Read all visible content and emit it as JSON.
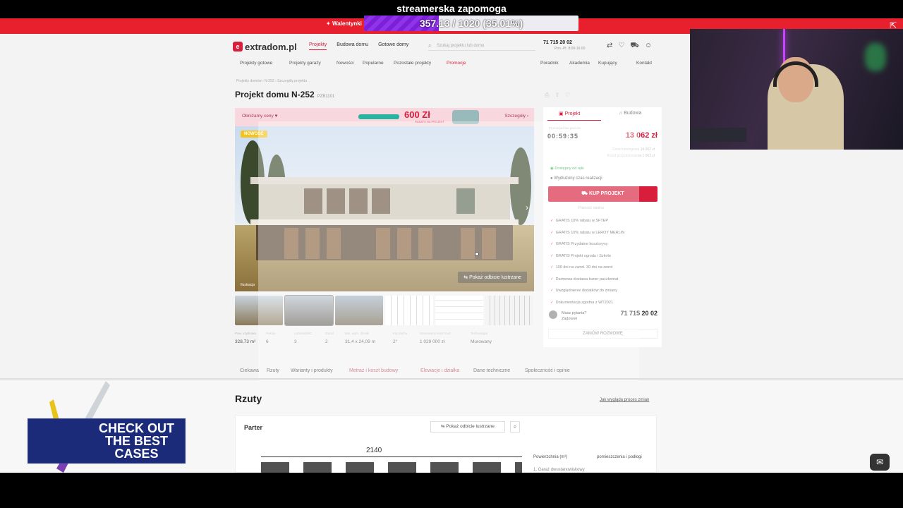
{
  "stream": {
    "title": "streamerska zapomoga",
    "badge_label": "Walentynki",
    "goal_text": "357.13 / 1020 (35.01%)",
    "goal_fraction": 0.3501
  },
  "site": {
    "logo": "extradom.pl",
    "nav": [
      "Projekty",
      "Budowa domu",
      "Gotowe domy"
    ],
    "search_placeholder": "Szukaj projektu lub domu",
    "phone": "71 715 20 02",
    "phone_sub": "Pon.-Pt. 8:00-16:00",
    "subnav_left": [
      "Projekty gotowe",
      "Projekty garaży",
      "Nowości",
      "Popularne",
      "Pozostałe projekty",
      "Promocje"
    ],
    "subnav_right": [
      "Poradnik",
      "Akademia",
      "Kupujący",
      "Kontakt"
    ],
    "breadcrumbs": "Projekty domów  ›  N-252  ›  Szczegóły projektu",
    "title": "Projekt domu N-252",
    "code": "PZB1101",
    "promo_left": "Obniżamy ceny",
    "promo_amount": "600 Zł",
    "promo_amount_sub": "RABATU NA PROJEKT",
    "promo_right": "Szczegóły",
    "hero_badge": "NOWOŚĆ",
    "hero_button": "Pokaż odbicie lustrzane",
    "hero_tag": "Ilustracja",
    "stats": [
      {
        "label": "Pow. użytkowa",
        "value": "328,73 m²"
      },
      {
        "label": "Pokoje",
        "value": "6"
      },
      {
        "label": "Łazienki/WC",
        "value": "3"
      },
      {
        "label": "Garaż",
        "value": "2"
      },
      {
        "label": "Min. wym. działki",
        "value": "31,4 x 24,09 m"
      },
      {
        "label": "Kąt dachu",
        "value": "2°"
      },
      {
        "label": "Szacowany koszt bud.",
        "value": "1 029 000 zł"
      },
      {
        "label": "Technologia",
        "value": "Murowany"
      }
    ],
    "panel": {
      "tab_project": "Projekt",
      "tab_build": "Budowa",
      "promo_small": "Promocja trwa jeszcze",
      "timer": "00:59:35",
      "price": "13 062 zł",
      "price_lines": [
        "Cena katalogowa 14 062 zł",
        "Koszt przystosowania 1 063 zł"
      ],
      "availability": "Dostępny od ręki",
      "lead_time": "Wydłużony czas realizacji",
      "buy_label": "KUP PROJEKT",
      "buy_sub": "Płatność ratalna",
      "checklist": [
        "GRATIS 10% rabatu w SFTEP",
        "GRATIS 10% rabatu w LEROY MERLIN",
        "GRATIS Przydatne kosztorysy",
        "GRATIS Projekt ogrodu i Szkoła",
        "100 dni na zwrot. 30 dni na zwrot",
        "Darmowa dostawa kurier paczkomat",
        "Uwzględnienie dodatków do zmiany",
        "Dokumentacja zgodna z WT2021"
      ],
      "contact_q": "Masz pytania?",
      "contact_sub": "Zadzwoń",
      "contact_phone": "71 715 20 02",
      "order_label": "ZAMÓW ROZMOWĘ"
    },
    "section_tabs": [
      "Ciekawa",
      "Rzuty",
      "Warianty i produkty",
      "Metraż i koszt budowy",
      "Elewacje i działka",
      "Dane techniczne",
      "Społeczność i opinie"
    ],
    "rzuty_title": "Rzuty",
    "rzuty_link": "Jak wygląda proces zmian",
    "parter": "Parter",
    "plan_button": "Pokaż odbicie lustrzane",
    "dimension": "2140",
    "rooms_header_1": "Powierzchnia (m²)",
    "rooms_header_2": "pomieszczenia i podłogi",
    "rooms_row_1": "1. Garaż dwustanowiskowy"
  },
  "ad": {
    "text": "CHECK OUT THE BEST CASES"
  },
  "colors": {
    "brand": "#d81e3a",
    "goal_fill": "#7d1fd8",
    "overlay_red": "#e8202e"
  }
}
